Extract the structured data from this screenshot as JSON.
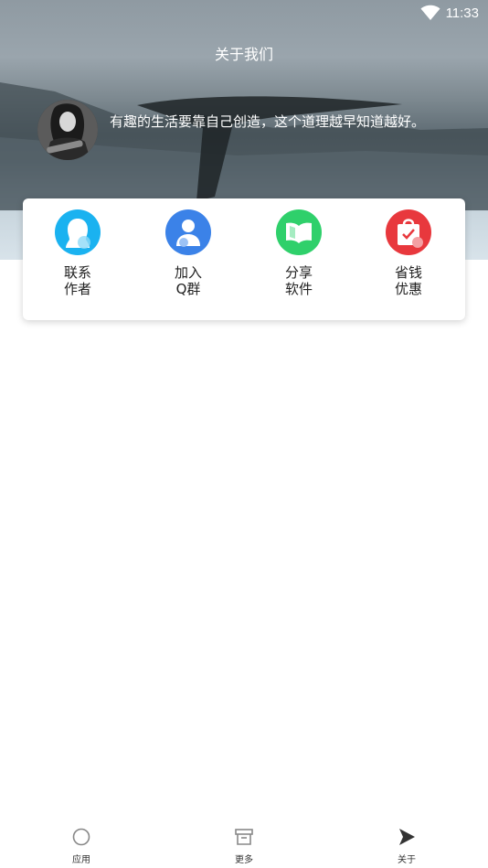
{
  "status_bar": {
    "time": "11:33",
    "wifi_icon": "wifi-icon"
  },
  "header": {
    "title": "关于我们"
  },
  "profile": {
    "motto": "有趣的生活要靠自己创造，这个道理越早知道越好。"
  },
  "actions": [
    {
      "label": "联系\n作者",
      "icon": "contact-author-icon",
      "color": "#1ab2f0"
    },
    {
      "label": "加入\nQ群",
      "icon": "join-group-icon",
      "color": "#3b82e8"
    },
    {
      "label": "分享\n软件",
      "icon": "share-book-icon",
      "color": "#2fd06b"
    },
    {
      "label": "省钱\n优惠",
      "icon": "discount-bag-icon",
      "color": "#e8383d"
    }
  ],
  "tabs": [
    {
      "label": "应用",
      "icon": "circle-icon"
    },
    {
      "label": "更多",
      "icon": "box-icon"
    },
    {
      "label": "关于",
      "icon": "play-icon"
    }
  ]
}
